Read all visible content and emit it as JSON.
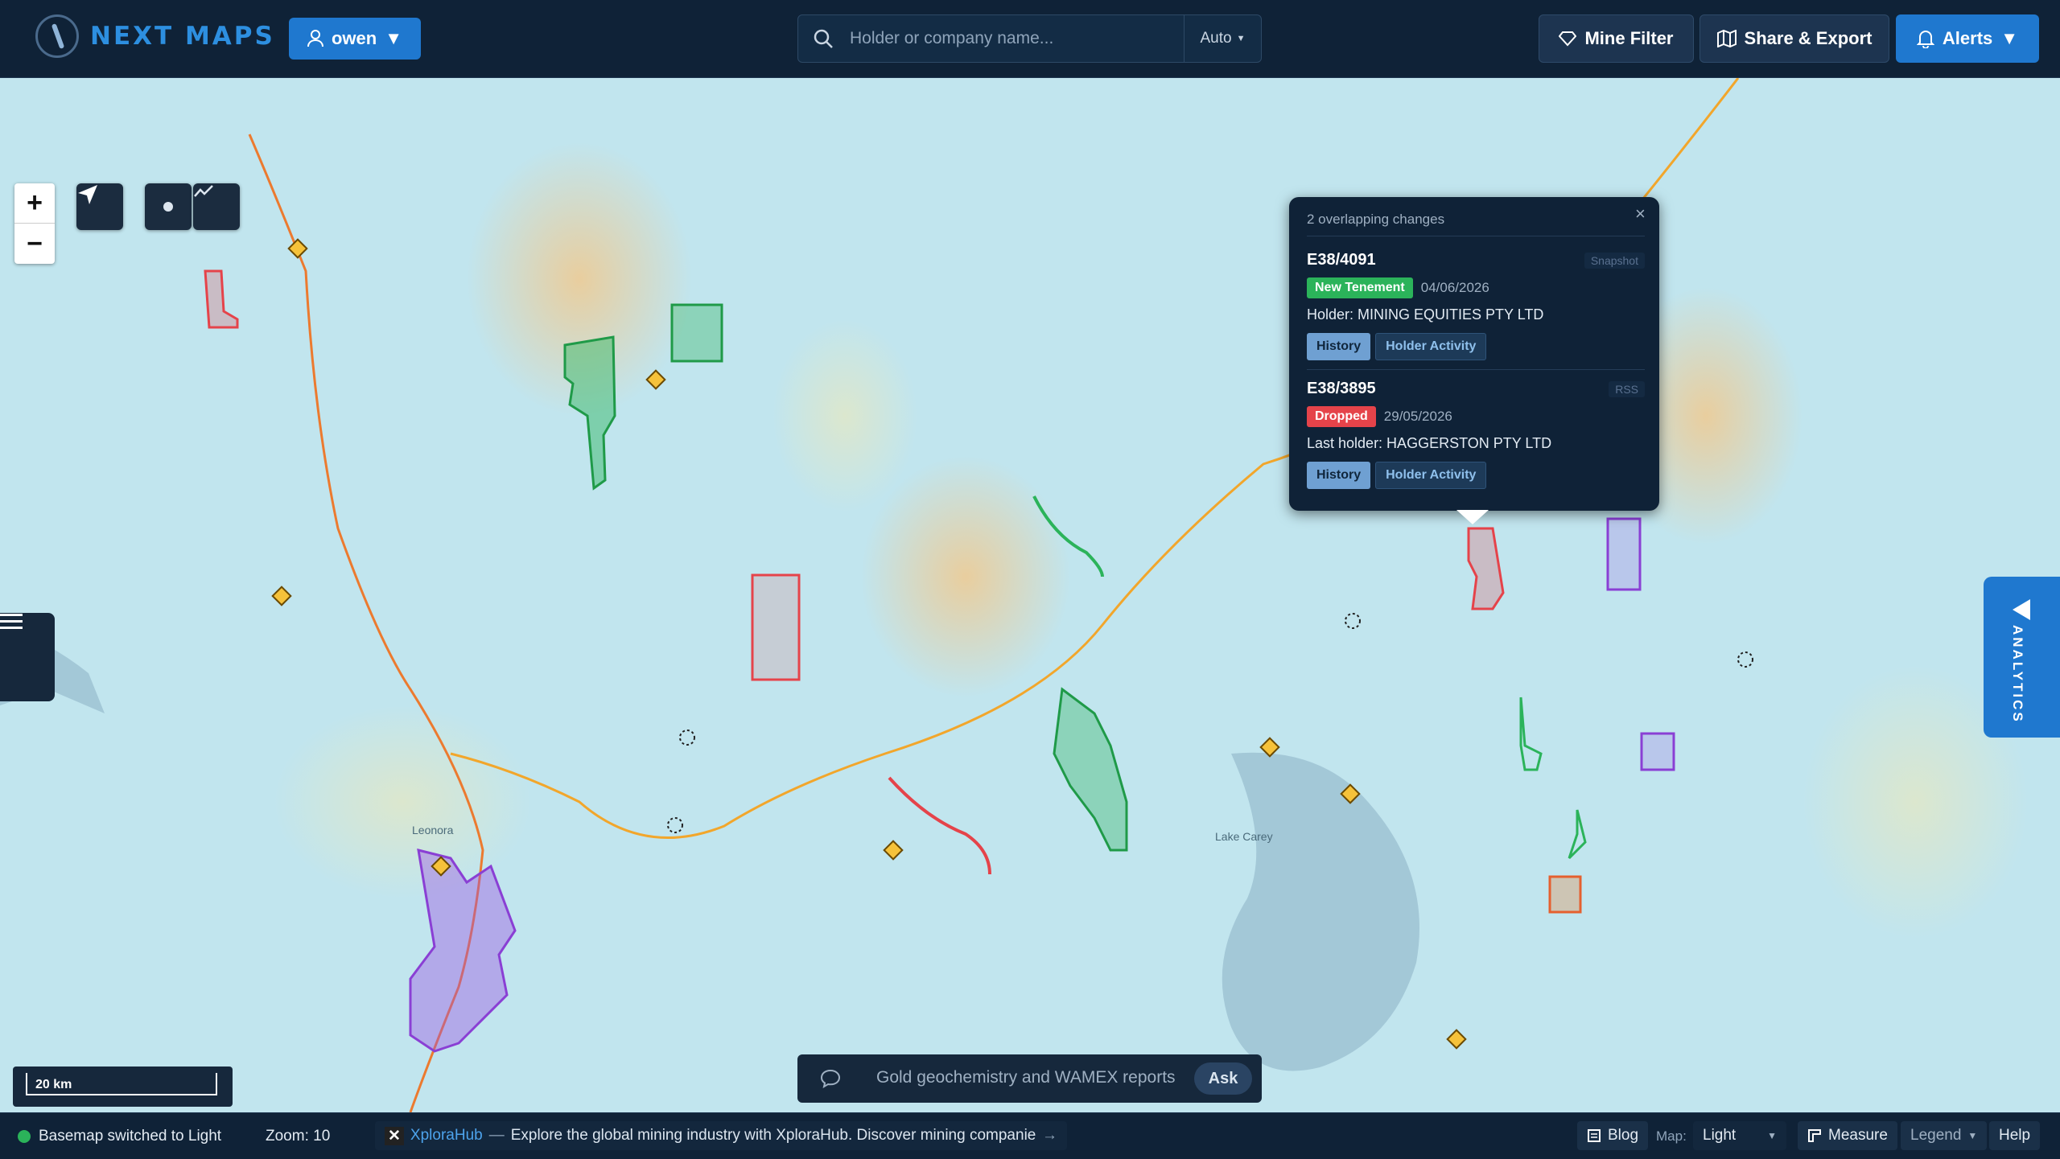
{
  "app": {
    "title": "NEXT MAPS",
    "user": "owen"
  },
  "search": {
    "placeholder": "Holder or company name...",
    "mode": "Auto"
  },
  "toolbar": {
    "mine_filter": "Mine Filter",
    "share_export": "Share & Export",
    "alerts": "Alerts"
  },
  "map": {
    "zoom_in": "+",
    "zoom_out": "−",
    "scale_label": "20 km",
    "analytics_label": "ANALYTICS",
    "place_label_1": "Leonora",
    "place_label_2": "Lake Carey"
  },
  "popup": {
    "header": "2 overlapping changes",
    "close": "×",
    "entries": [
      {
        "id": "E38/4091",
        "source": "Snapshot",
        "status": "New Tenement",
        "status_color": "#2bb35a",
        "date": "04/06/2026",
        "holder": "Holder: MINING EQUITIES PTY LTD",
        "history": "History",
        "activity": "Holder Activity"
      },
      {
        "id": "E38/3895",
        "source": "RSS",
        "status": "Dropped",
        "status_color": "#e5434a",
        "date": "29/05/2026",
        "holder": "Last holder: HAGGERSTON PTY LTD",
        "history": "History",
        "activity": "Holder Activity"
      }
    ]
  },
  "ask": {
    "question": "Gold geochemistry and WAMEX reports",
    "button": "Ask"
  },
  "status": {
    "basemap": "Basemap switched to Light",
    "zoom": "Zoom: 10",
    "ticker_source": "XploraHub",
    "ticker_dash": "—",
    "ticker_text": "Explore the global mining industry with XploraHub. Discover mining companies, ...",
    "ticker_arrow": "→",
    "blog": "Blog",
    "map_label": "Map:",
    "map_value": "Light",
    "measure": "Measure",
    "legend": "Legend",
    "help": "Help"
  },
  "colors": {
    "accent": "#1f78cf",
    "new": "#2bb35a",
    "dropped": "#e5434a",
    "tenement_purple": "#9b4fe0",
    "road": "#f2a62b"
  }
}
